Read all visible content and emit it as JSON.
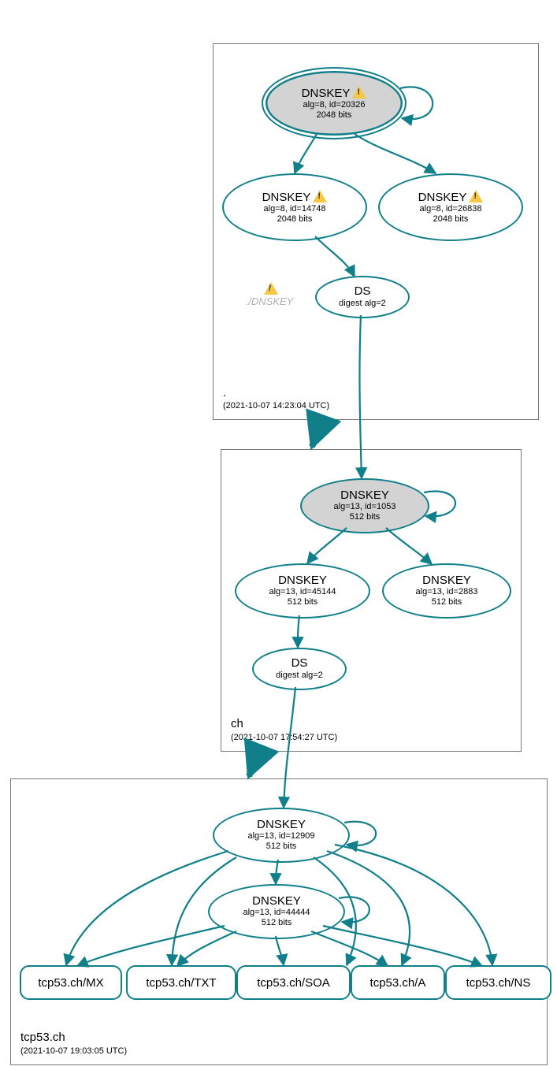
{
  "zones": {
    "root": {
      "name": ".",
      "ts": "(2021-10-07 14:23:04 UTC)"
    },
    "ch": {
      "name": "ch",
      "ts": "(2021-10-07 17:54:27 UTC)"
    },
    "leaf": {
      "name": "tcp53.ch",
      "ts": "(2021-10-07 19:03:05 UTC)"
    }
  },
  "nodes": {
    "root_ksk": {
      "title": "DNSKEY",
      "l1": "alg=8, id=20326",
      "l2": "2048 bits",
      "warn": true
    },
    "root_zsk1": {
      "title": "DNSKEY",
      "l1": "alg=8, id=14748",
      "l2": "2048 bits",
      "warn": true
    },
    "root_zsk2": {
      "title": "DNSKEY",
      "l1": "alg=8, id=26838",
      "l2": "2048 bits",
      "warn": true
    },
    "root_ds": {
      "title": "DS",
      "l1": "digest alg=2"
    },
    "root_ghost": {
      "label": "./DNSKEY",
      "warn": true
    },
    "ch_ksk": {
      "title": "DNSKEY",
      "l1": "alg=13, id=1053",
      "l2": "512 bits"
    },
    "ch_zsk1": {
      "title": "DNSKEY",
      "l1": "alg=13, id=45144",
      "l2": "512 bits"
    },
    "ch_zsk2": {
      "title": "DNSKEY",
      "l1": "alg=13, id=2883",
      "l2": "512 bits"
    },
    "ch_ds": {
      "title": "DS",
      "l1": "digest alg=2"
    },
    "leaf_ksk": {
      "title": "DNSKEY",
      "l1": "alg=13, id=12909",
      "l2": "512 bits"
    },
    "leaf_zsk": {
      "title": "DNSKEY",
      "l1": "alg=13, id=44444",
      "l2": "512 bits"
    },
    "rr_mx": {
      "label": "tcp53.ch/MX"
    },
    "rr_txt": {
      "label": "tcp53.ch/TXT"
    },
    "rr_soa": {
      "label": "tcp53.ch/SOA"
    },
    "rr_a": {
      "label": "tcp53.ch/A"
    },
    "rr_ns": {
      "label": "tcp53.ch/NS"
    }
  }
}
